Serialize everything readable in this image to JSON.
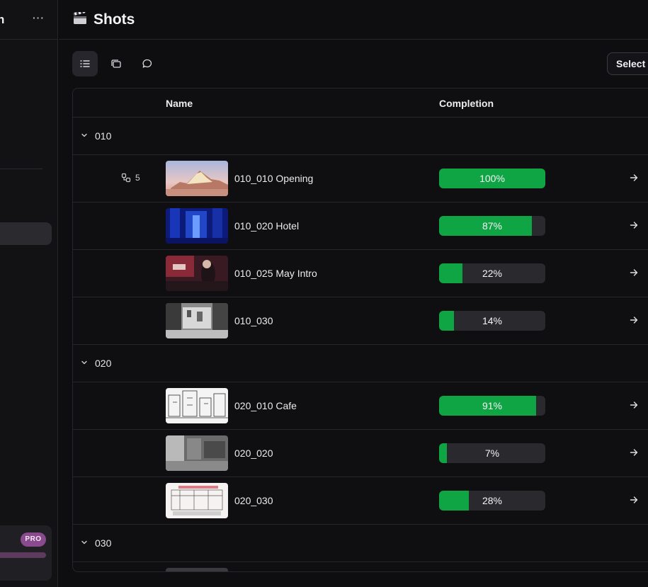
{
  "sidebar": {
    "title": "n",
    "more_label": "···",
    "pro_badge": "PRO"
  },
  "header": {
    "title": "Shots",
    "icon": "clapperboard-icon"
  },
  "toolbar": {
    "views": [
      "list-view-icon",
      "gallery-view-icon",
      "comments-view-icon"
    ],
    "active_view": "list-view-icon",
    "select_label": "Select"
  },
  "table": {
    "columns": {
      "name": "Name",
      "completion": "Completion"
    },
    "groups": [
      {
        "label": "010",
        "shots": [
          {
            "name": "010_010 Opening",
            "completion": 100,
            "completion_label": "100%",
            "links": "5"
          },
          {
            "name": "010_020 Hotel",
            "completion": 87,
            "completion_label": "87%"
          },
          {
            "name": "010_025 May Intro",
            "completion": 22,
            "completion_label": "22%"
          },
          {
            "name": "010_030",
            "completion": 14,
            "completion_label": "14%"
          }
        ]
      },
      {
        "label": "020",
        "shots": [
          {
            "name": "020_010 Cafe",
            "completion": 91,
            "completion_label": "91%"
          },
          {
            "name": "020_020",
            "completion": 7,
            "completion_label": "7%"
          },
          {
            "name": "020_030",
            "completion": 28,
            "completion_label": "28%"
          }
        ]
      },
      {
        "label": "030",
        "shots": []
      }
    ]
  },
  "colors": {
    "progress_fill": "#10a544",
    "progress_track": "#2a2a2e",
    "pro_badge": "#8a4a8e"
  }
}
